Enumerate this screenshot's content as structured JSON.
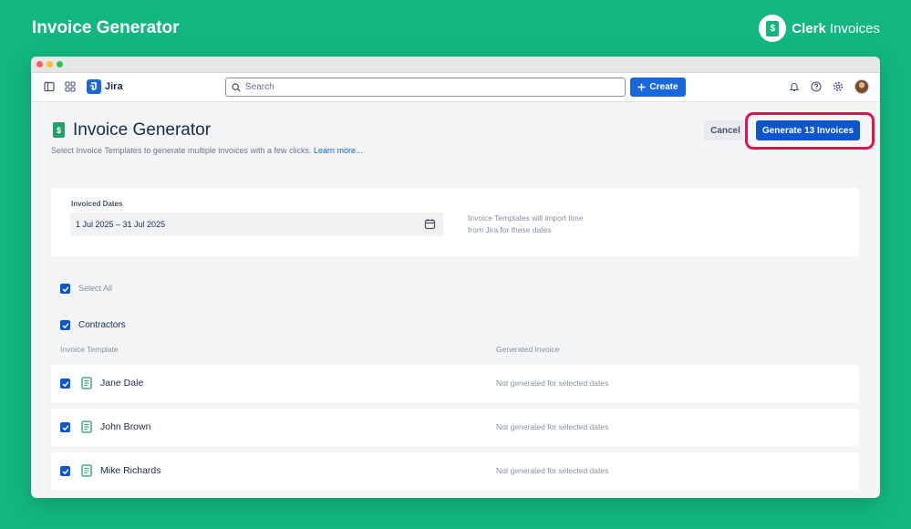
{
  "banner": {
    "title": "Invoice Generator",
    "brand_name": "Clerk",
    "brand_suffix": "Invoices",
    "brand_logo_glyph": "$"
  },
  "topnav": {
    "product": "Jira",
    "search_placeholder": "Search",
    "create_label": "Create",
    "icons": [
      "sidebar-toggle-icon",
      "app-switcher-icon",
      "bell-icon",
      "help-icon",
      "gear-icon",
      "avatar"
    ]
  },
  "header": {
    "title": "Invoice Generator",
    "subtitle": "Select Invoice Templates to generate multiple invoices with a few clicks.",
    "learn_more": "Learn more...",
    "cancel_label": "Cancel",
    "generate_label": "Generate 13 Invoices"
  },
  "dates": {
    "label": "Invoiced Dates",
    "value": "1 Jul 2025 – 31 Jul 2025",
    "hint_line1": "Invoice Templates will import time",
    "hint_line2": "from Jira for these dates"
  },
  "selection": {
    "select_all_label": "Select All",
    "select_all_checked": true,
    "group_label": "Contractors",
    "group_checked": true,
    "columns": {
      "template": "Invoice Template",
      "generated": "Generated Invoice"
    },
    "rows": [
      {
        "name": "Jane Dale",
        "status": "Not generated for selected dates",
        "checked": true
      },
      {
        "name": "John Brown",
        "status": "Not generated for selected dates",
        "checked": true
      },
      {
        "name": "Mike Richards",
        "status": "Not generated for selected dates",
        "checked": true
      }
    ]
  },
  "colors": {
    "background": "#12b77e",
    "primary_button": "#0c55cc",
    "highlight": "#e2134c",
    "template_icon": "#22a06b"
  }
}
